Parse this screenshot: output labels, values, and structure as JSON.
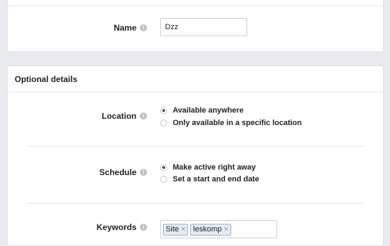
{
  "basic": {
    "name_label": "Name",
    "name_value": "Dzz"
  },
  "optional": {
    "title": "Optional details",
    "location": {
      "label": "Location",
      "options": [
        "Available anywhere",
        "Only available in a specific location"
      ],
      "selected": 0
    },
    "schedule": {
      "label": "Schedule",
      "options": [
        "Make active right away",
        "Set a start and end date"
      ],
      "selected": 0
    },
    "keywords": {
      "label": "Keywords",
      "tags": [
        "Site",
        "leskomp"
      ],
      "remove_glyph": "×"
    }
  },
  "icons": {
    "info": "i"
  }
}
